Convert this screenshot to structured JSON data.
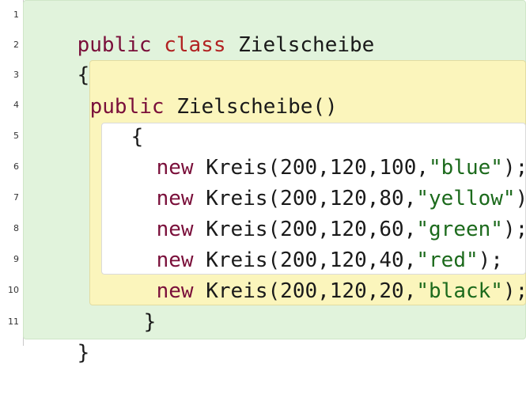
{
  "line_numbers": [
    "1",
    "2",
    "3",
    "4",
    "5",
    "6",
    "7",
    "8",
    "9",
    "10",
    "11"
  ],
  "code": {
    "line1": {
      "kw_public": "public",
      "kw_class": "class",
      "name": "Zielscheibe"
    },
    "line2": {
      "brace": "{"
    },
    "line3": {
      "kw_public": "public",
      "signature": "Zielscheibe()"
    },
    "line4": {
      "brace": "{"
    },
    "calls": [
      {
        "kw_new": "new",
        "call": "Kreis(200,120,100,",
        "arg": "\"blue\"",
        "end": ");"
      },
      {
        "kw_new": "new",
        "call": "Kreis(200,120,80,",
        "arg": "\"yellow\"",
        "end": ");"
      },
      {
        "kw_new": "new",
        "call": "Kreis(200,120,60,",
        "arg": "\"green\"",
        "end": ");"
      },
      {
        "kw_new": "new",
        "call": "Kreis(200,120,40,",
        "arg": "\"red\"",
        "end": ");"
      },
      {
        "kw_new": "new",
        "call": "Kreis(200,120,20,",
        "arg": "\"black\"",
        "end": ");"
      }
    ],
    "line10": {
      "brace": "}"
    },
    "line11": {
      "brace": "}"
    }
  },
  "colors": {
    "keyword": "#7a0f3a",
    "class_keyword": "#b22222",
    "string": "#1c6a1c",
    "class_scope": "#e1f3dc",
    "method_scope": "#fbf5bc",
    "inner_scope": "#ffffff"
  }
}
